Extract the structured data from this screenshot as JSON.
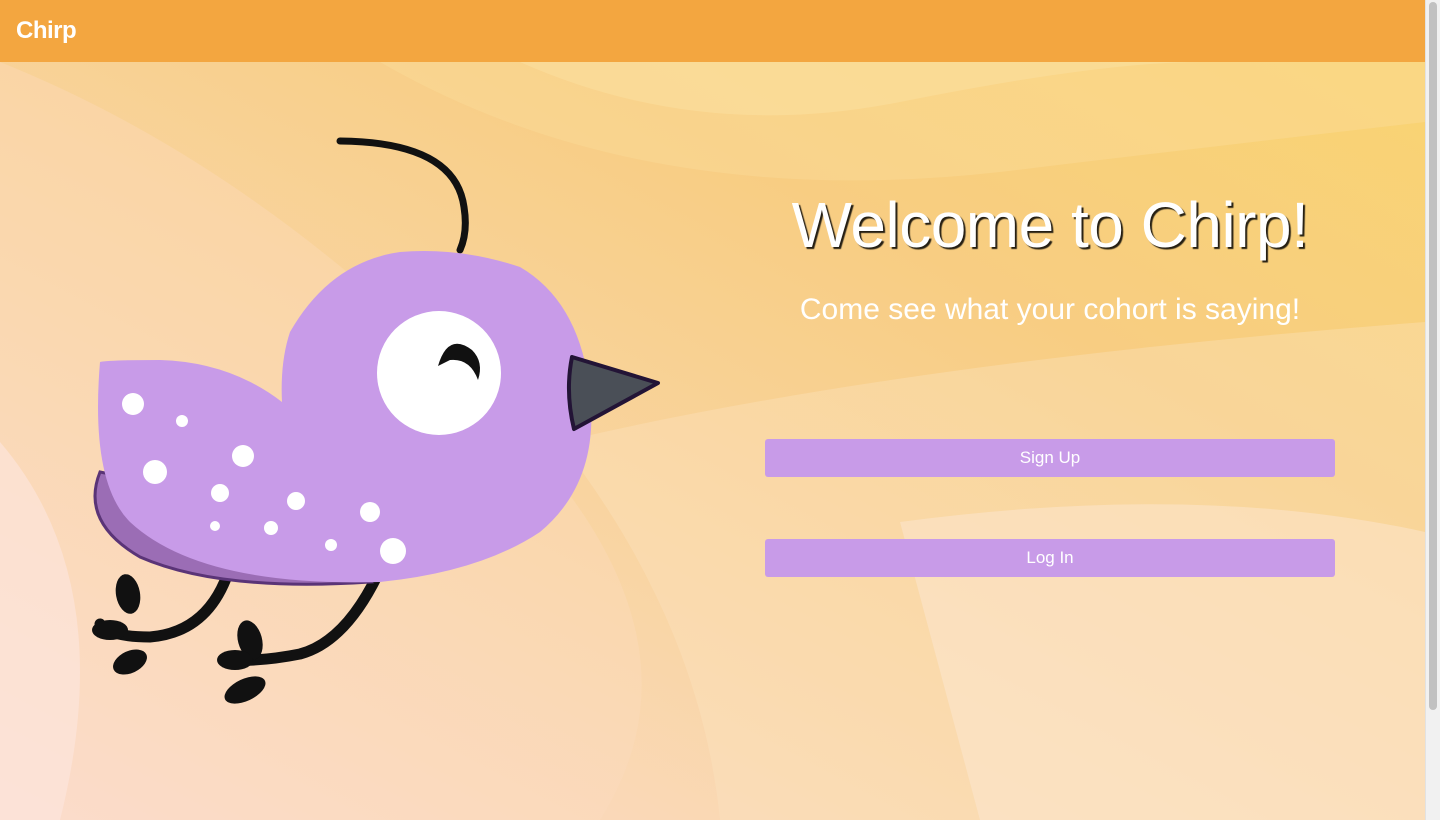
{
  "navbar": {
    "brand": "Chirp"
  },
  "hero": {
    "title": "Welcome to Chirp!",
    "subtitle": "Come see what your cohort is saying!",
    "signup_label": "Sign Up",
    "login_label": "Log In"
  },
  "illustration": {
    "icon": "bird-mascot-icon"
  },
  "colors": {
    "navbar": "#f3a640",
    "button": "#c89be8",
    "bird_body": "#c89be8",
    "bird_wing": "#9b6db5",
    "beak": "#4a4f57",
    "text": "#ffffff"
  }
}
